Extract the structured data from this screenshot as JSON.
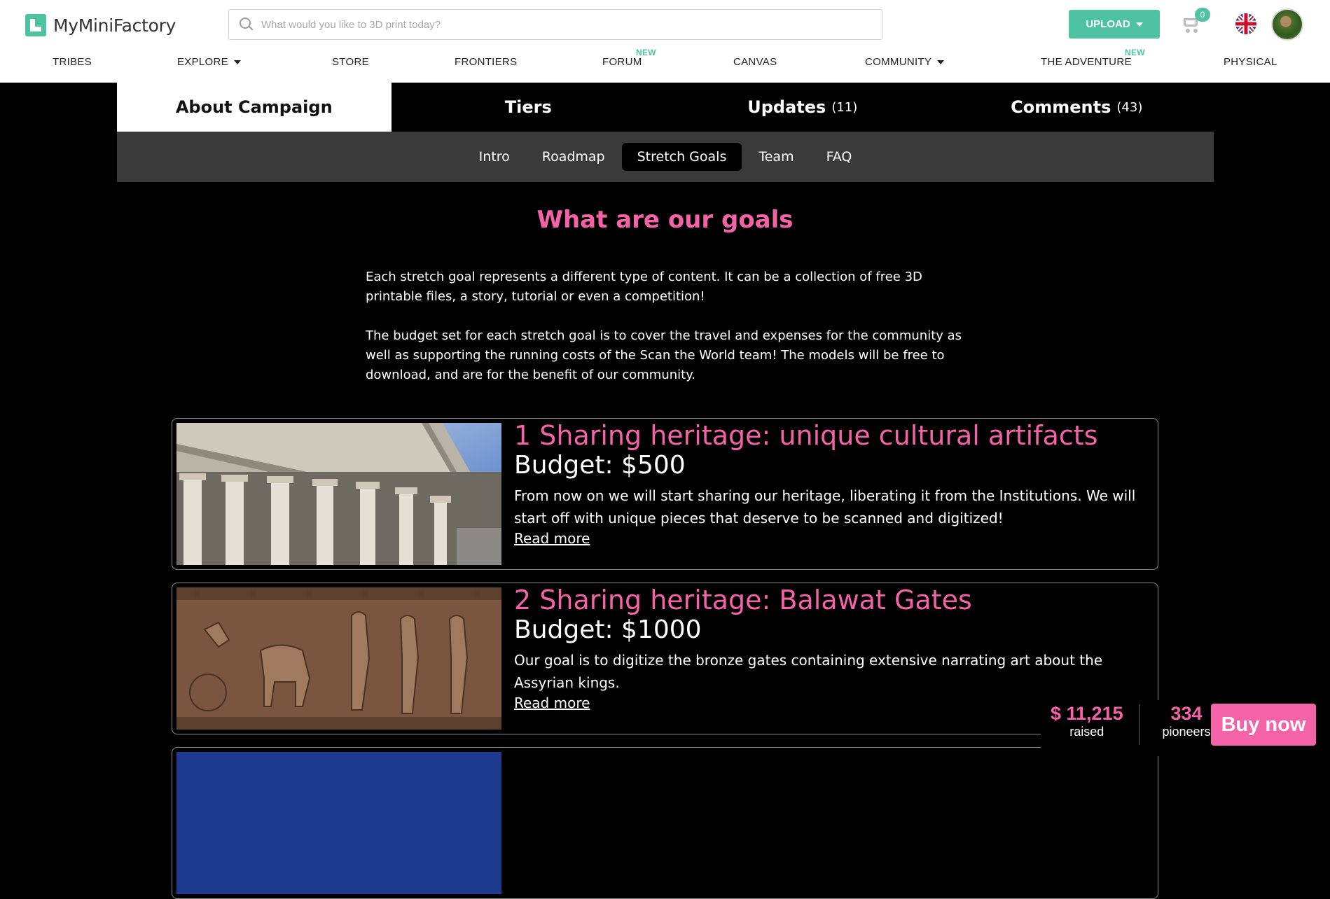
{
  "header": {
    "logo_text": "MyMiniFactory",
    "search_placeholder": "What would you like to 3D print today?",
    "upload_label": "UPLOAD",
    "cart_count": "0"
  },
  "nav": {
    "items": [
      {
        "label": "TRIBES"
      },
      {
        "label": "EXPLORE"
      },
      {
        "label": "STORE"
      },
      {
        "label": "FRONTIERS"
      },
      {
        "label": "FORUM",
        "badge": "NEW"
      },
      {
        "label": "CANVAS"
      },
      {
        "label": "COMMUNITY"
      },
      {
        "label": "THE ADVENTURE",
        "badge": "NEW"
      },
      {
        "label": "PHYSICAL"
      }
    ]
  },
  "tabs": [
    {
      "label": "About Campaign",
      "count": ""
    },
    {
      "label": "Tiers",
      "count": ""
    },
    {
      "label": "Updates",
      "count": "(11)"
    },
    {
      "label": "Comments",
      "count": "(43)"
    }
  ],
  "subnav": [
    "Intro",
    "Roadmap",
    "Stretch Goals",
    "Team",
    "FAQ"
  ],
  "section": {
    "title": "What are our goals",
    "paragraphs": [
      "Each stretch goal represents a different type of content. It can be a collection of free 3D printable files, a story, tutorial or even a competition!",
      "The budget set for each stretch goal is to cover the travel and expenses for the community as well as supporting the running costs of the Scan the World team! The models will be free to download, and are for the benefit of our community."
    ]
  },
  "goals": [
    {
      "title": "1 Sharing heritage: unique cultural artifacts",
      "budget": "Budget: $500",
      "description": "From now on we will start sharing our heritage, liberating it from the Institutions. We will start off with unique pieces that deserve to be scanned and digitized!",
      "read_more": "Read more"
    },
    {
      "title": "2 Sharing heritage: Balawat Gates",
      "budget": "Budget: $1000",
      "description": "Our goal is to digitize the bronze gates containing extensive narrating art about the Assyrian kings.",
      "read_more": "Read more"
    }
  ],
  "funding": {
    "amount": "$ 11,215",
    "amount_label": "raised",
    "pioneers": "334",
    "pioneers_label": "pioneers",
    "buy_label": "Buy now"
  },
  "colors": {
    "accent_green": "#4fc3a1",
    "accent_pink": "#f462a8"
  }
}
